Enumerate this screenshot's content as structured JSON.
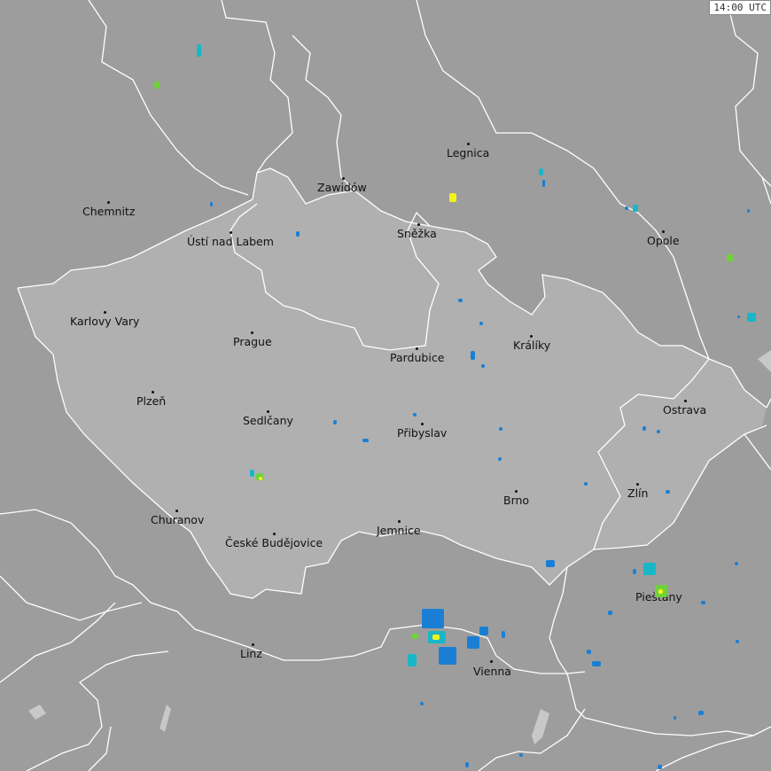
{
  "timestamp": "14:00 UTC",
  "colors": {
    "background": "#9d9d9d",
    "country_highlight": "#b0b0b0",
    "border_line": "#ffffff",
    "water": "#c8c8c8"
  },
  "cities": {
    "legnica": "Legnica",
    "zawidow": "Zawidów",
    "chemnitz": "Chemnitz",
    "usti": "Ústí nad Labem",
    "snezka": "Sněžka",
    "opole": "Opole",
    "karlovy_vary": "Karlovy Vary",
    "prague": "Prague",
    "pardubice": "Pardubice",
    "kraliky": "Králíky",
    "plzen": "Plzeň",
    "ostrava": "Ostrava",
    "sedlcany": "Sedlčany",
    "pribyslav": "Přibyslav",
    "zlin": "Zlín",
    "brno": "Brno",
    "churanov": "Churanov",
    "jemnice": "Jemnice",
    "ceske_budejovice": "České Budějovice",
    "piestany": "Piešťany",
    "linz": "Linz",
    "vienna": "Vienna"
  },
  "echo_colors": {
    "weak": "#1a7fd4",
    "moderate": "#19b6c8",
    "strong": "#6fd23a",
    "very_strong": "#f2f21a"
  }
}
